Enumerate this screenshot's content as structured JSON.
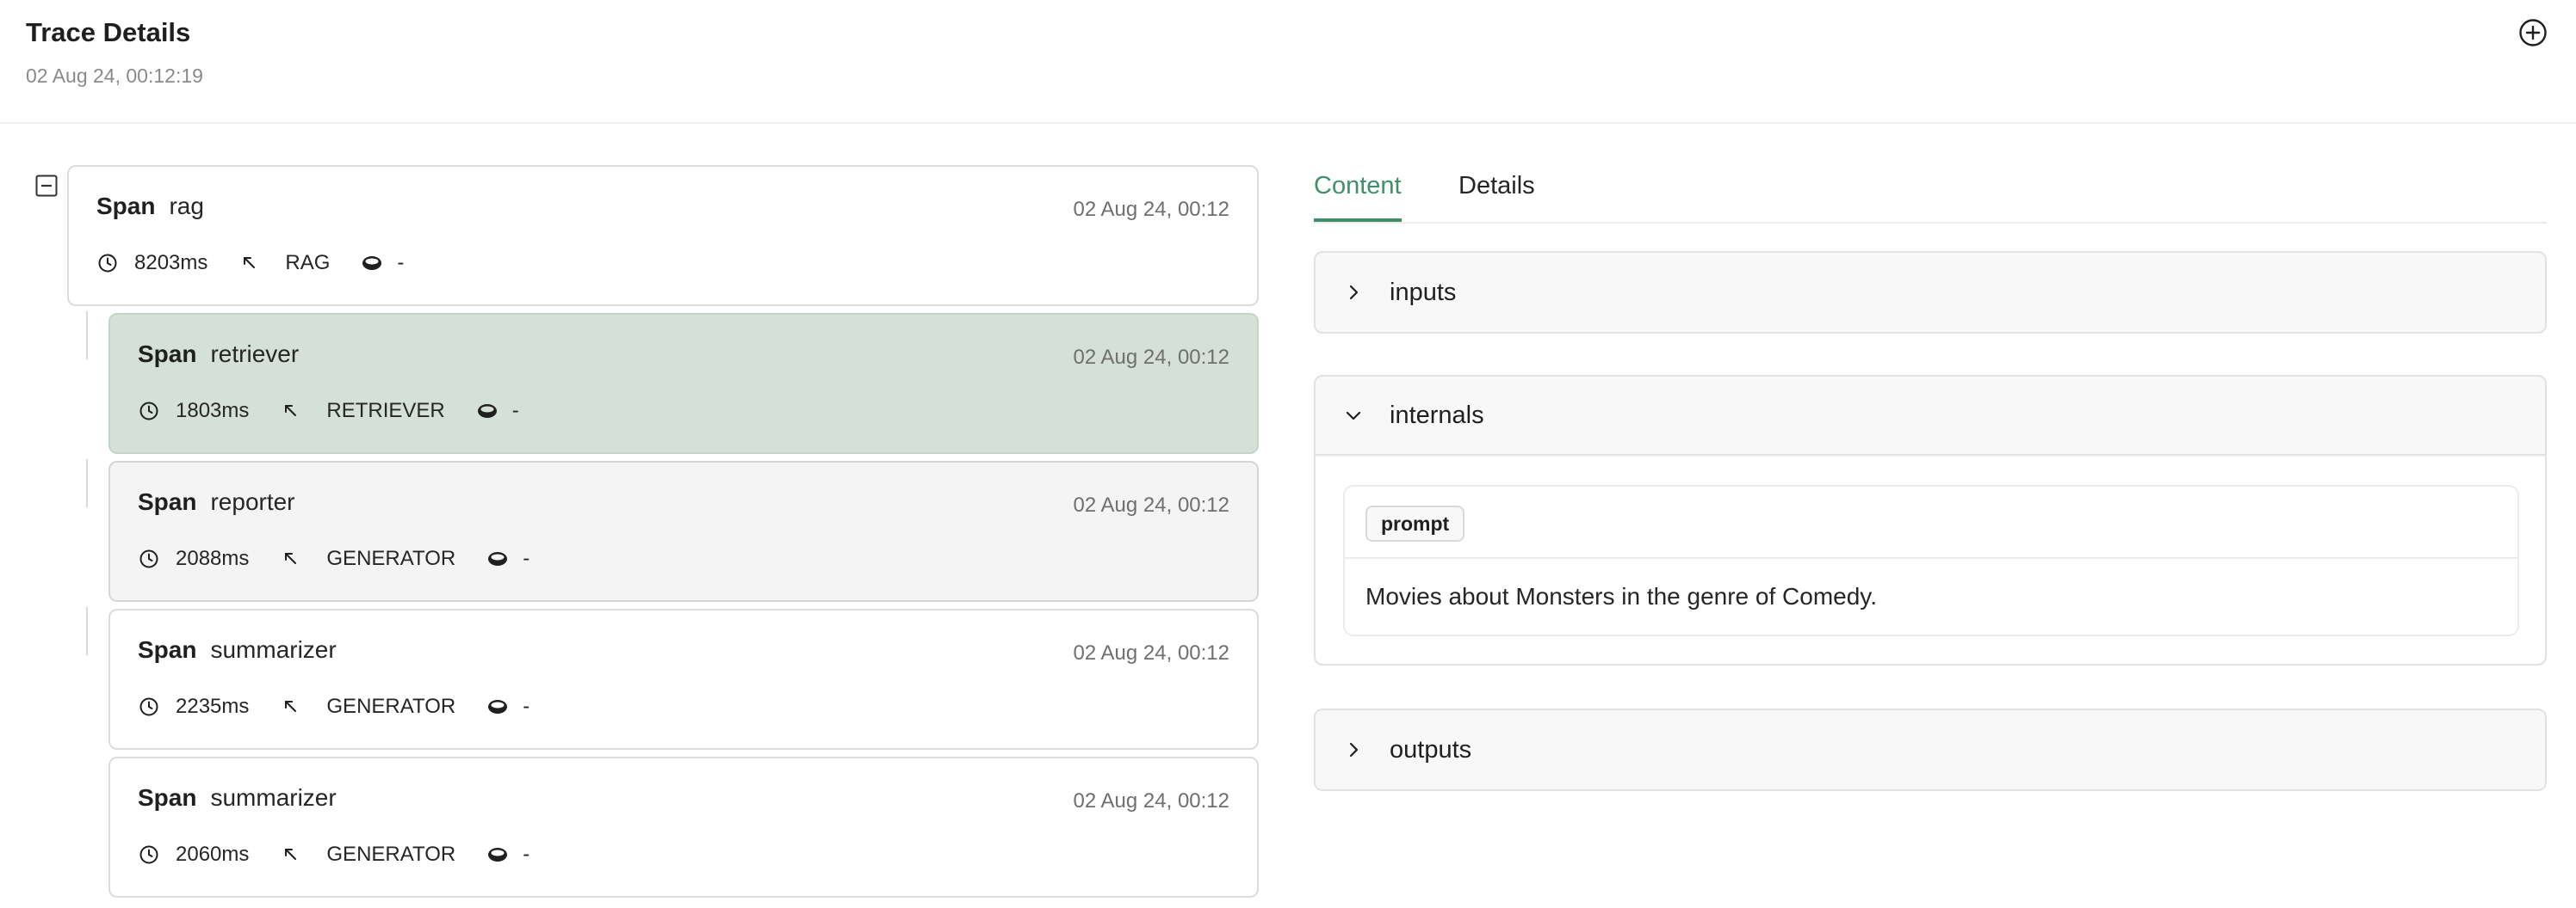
{
  "header": {
    "title": "Trace Details",
    "timestamp": "02 Aug 24, 00:12:19"
  },
  "spans": [
    {
      "kind": "Span",
      "name": "rag",
      "time": "02 Aug 24, 00:12",
      "duration": "8203ms",
      "type": "RAG",
      "tokens": "-"
    },
    {
      "kind": "Span",
      "name": "retriever",
      "time": "02 Aug 24, 00:12",
      "duration": "1803ms",
      "type": "RETRIEVER",
      "tokens": "-"
    },
    {
      "kind": "Span",
      "name": "reporter",
      "time": "02 Aug 24, 00:12",
      "duration": "2088ms",
      "type": "GENERATOR",
      "tokens": "-"
    },
    {
      "kind": "Span",
      "name": "summarizer",
      "time": "02 Aug 24, 00:12",
      "duration": "2235ms",
      "type": "GENERATOR",
      "tokens": "-"
    },
    {
      "kind": "Span",
      "name": "summarizer",
      "time": "02 Aug 24, 00:12",
      "duration": "2060ms",
      "type": "GENERATOR",
      "tokens": "-"
    }
  ],
  "tabs": {
    "content": "Content",
    "details": "Details"
  },
  "sections": {
    "inputs": "inputs",
    "internals": "internals",
    "outputs": "outputs"
  },
  "internals": {
    "key": "prompt",
    "value": "Movies about Monsters in the genre of Comedy."
  },
  "colors": {
    "accent": "#3f8f6a",
    "selected_bg": "#d5e0d8",
    "hovered_bg": "#f4f4f4"
  },
  "icons": {
    "add": "plus-circle-icon",
    "collapse": "minus-square-icon",
    "duration": "clock-icon",
    "type": "arrow-up-left-icon",
    "tokens": "coin-icon",
    "collapsed": "chevron-right-icon",
    "expanded": "chevron-down-icon"
  }
}
